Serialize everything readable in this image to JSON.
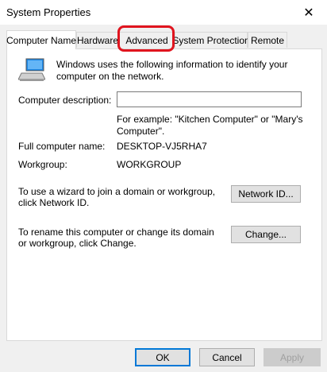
{
  "window": {
    "title": "System Properties",
    "close_glyph": "✕"
  },
  "tabs": [
    {
      "label": "Computer Name",
      "active": true
    },
    {
      "label": "Hardware",
      "active": false
    },
    {
      "label": "Advanced",
      "active": false
    },
    {
      "label": "System Protection",
      "active": false
    },
    {
      "label": "Remote",
      "active": false
    }
  ],
  "highlight_color": "#e0141e",
  "panel": {
    "intro": "Windows uses the following information to identify your computer on the network.",
    "description_label": "Computer description:",
    "description_value": "",
    "example": "For example: \"Kitchen Computer\" or \"Mary's Computer\".",
    "full_name_label": "Full computer name:",
    "full_name_value": "DESKTOP-VJ5RHA7",
    "workgroup_label": "Workgroup:",
    "workgroup_value": "WORKGROUP",
    "network_id_text": "To use a wizard to join a domain or workgroup, click Network ID.",
    "network_id_button": "Network ID...",
    "change_text": "To rename this computer or change its domain or workgroup, click Change.",
    "change_button": "Change..."
  },
  "footer": {
    "ok": "OK",
    "cancel": "Cancel",
    "apply": "Apply"
  }
}
